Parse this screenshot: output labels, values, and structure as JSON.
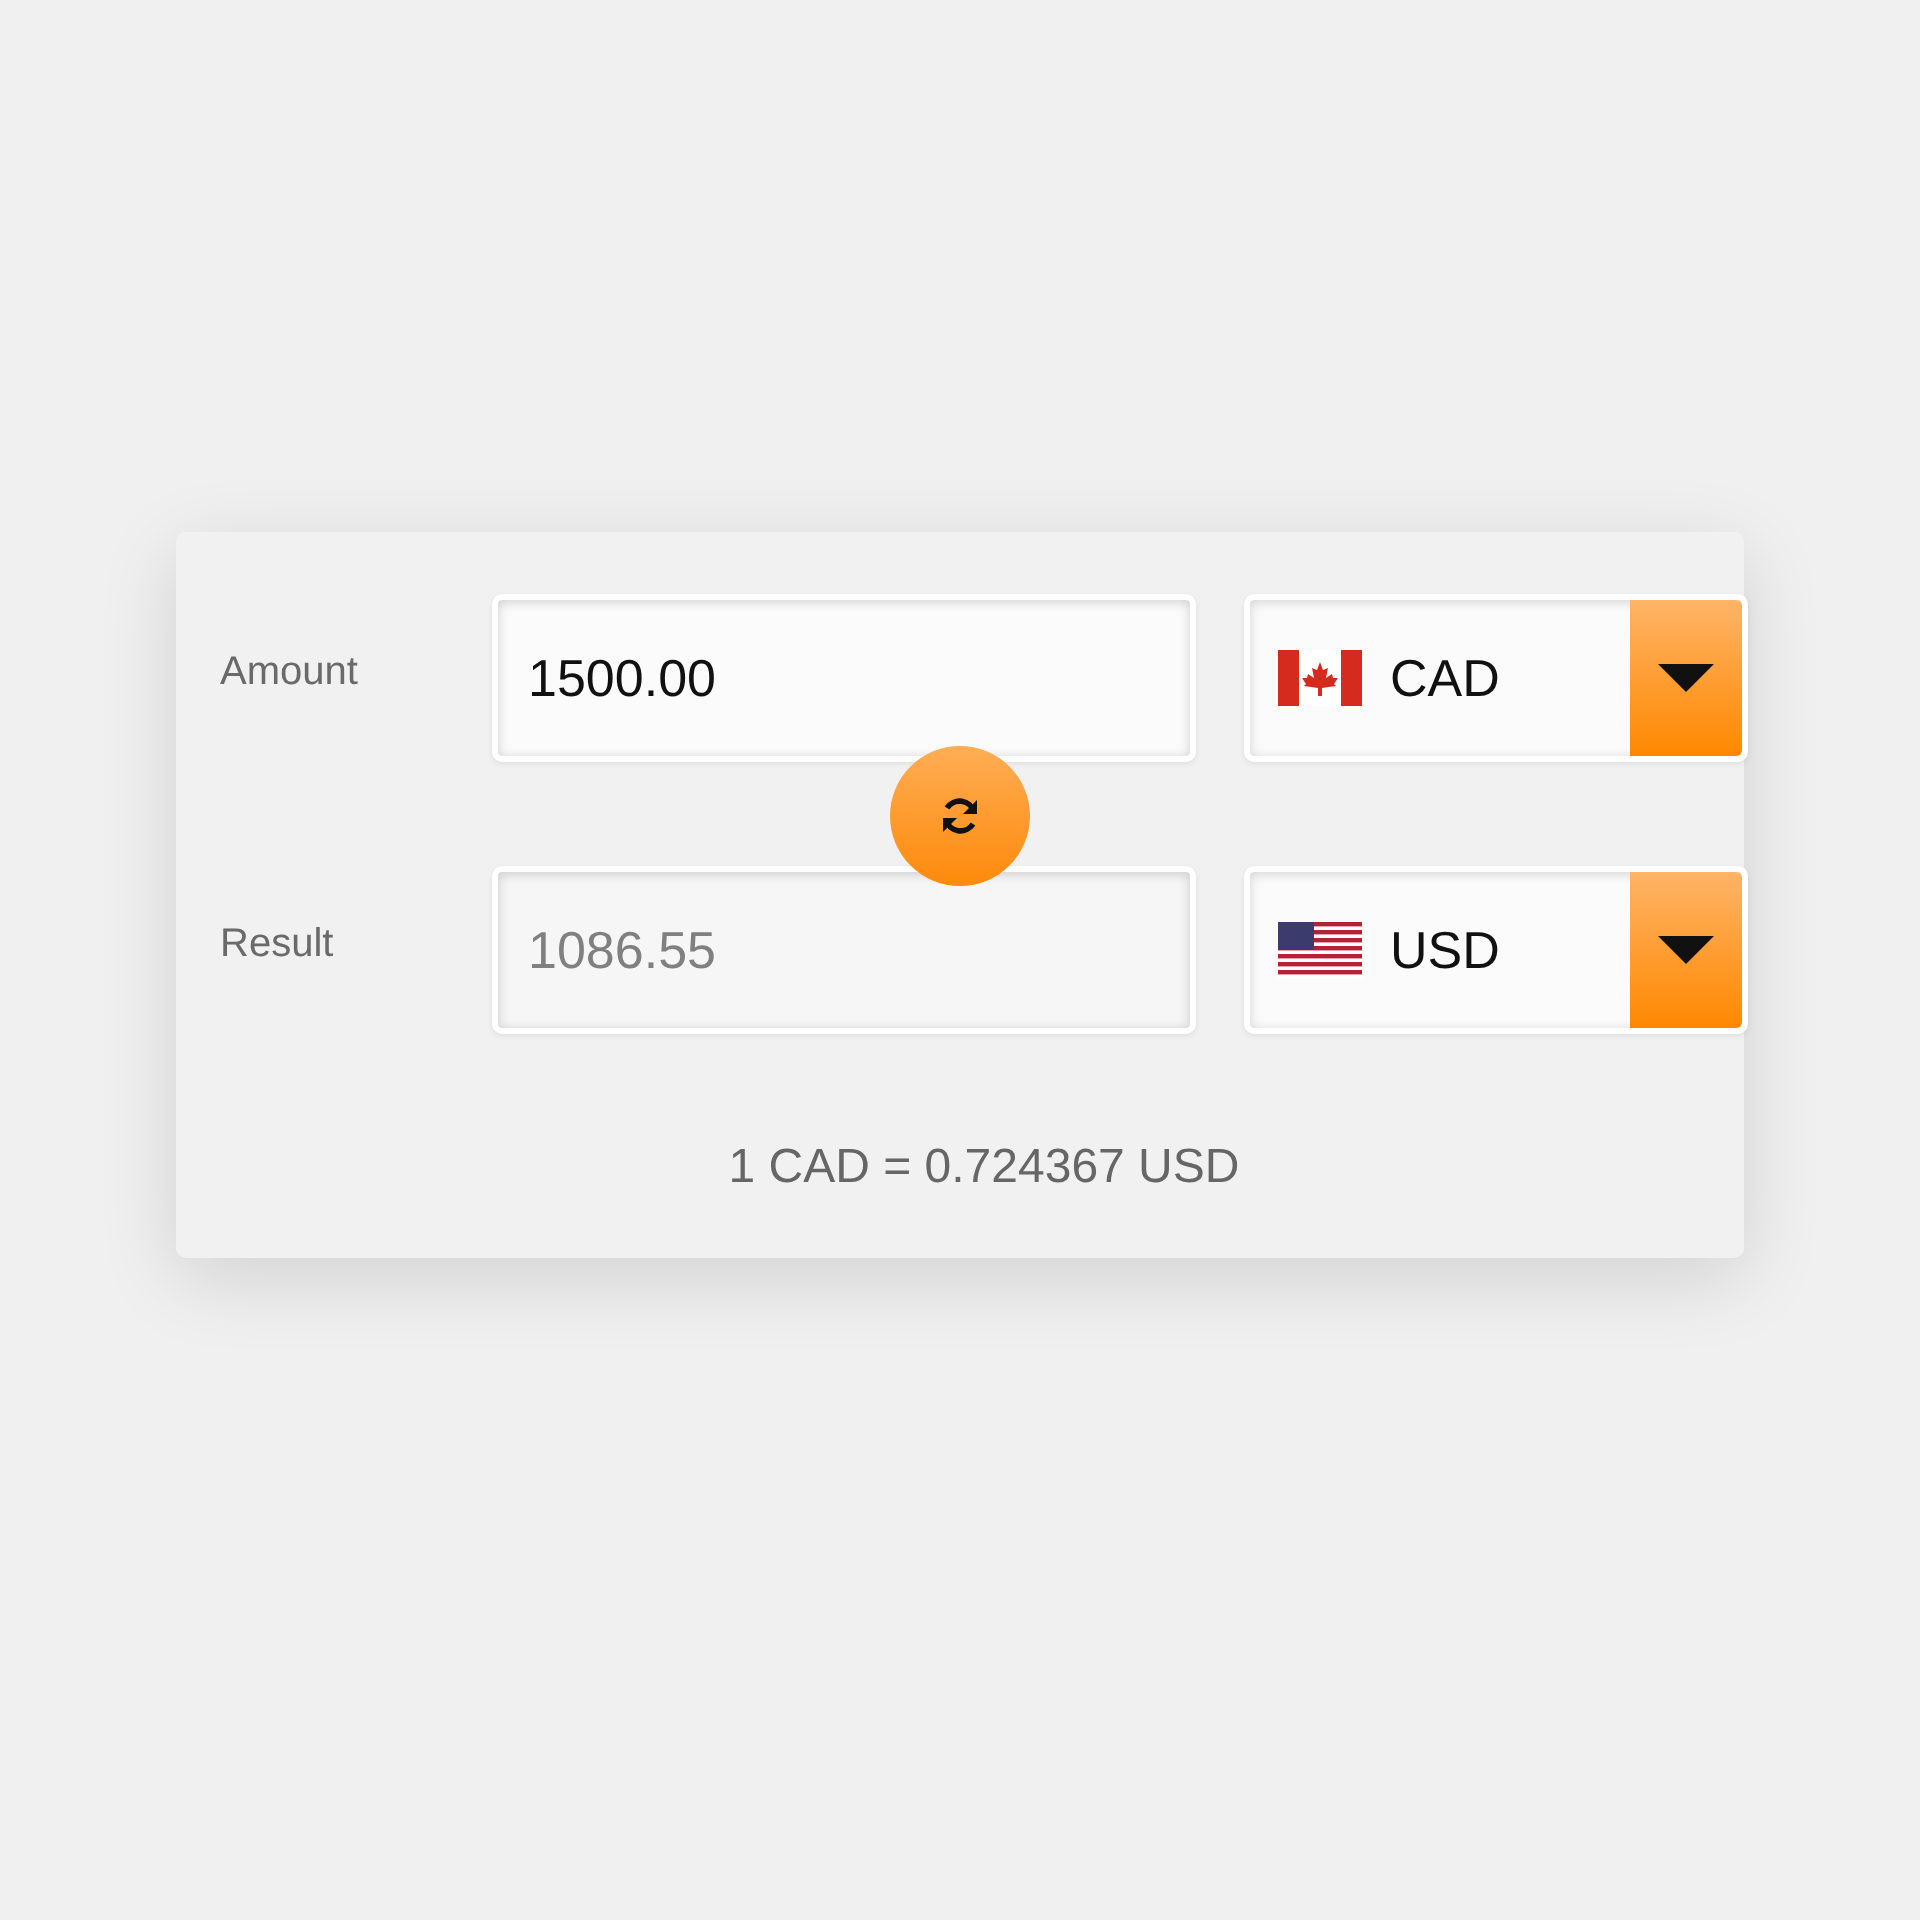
{
  "rows": [
    {
      "label": "Amount",
      "value": "1500.00",
      "readonly": false,
      "currency": "CAD"
    },
    {
      "label": "Result",
      "value": "1086.55",
      "readonly": true,
      "currency": "USD"
    }
  ],
  "rate": "1 CAD = 0.724367 USD"
}
